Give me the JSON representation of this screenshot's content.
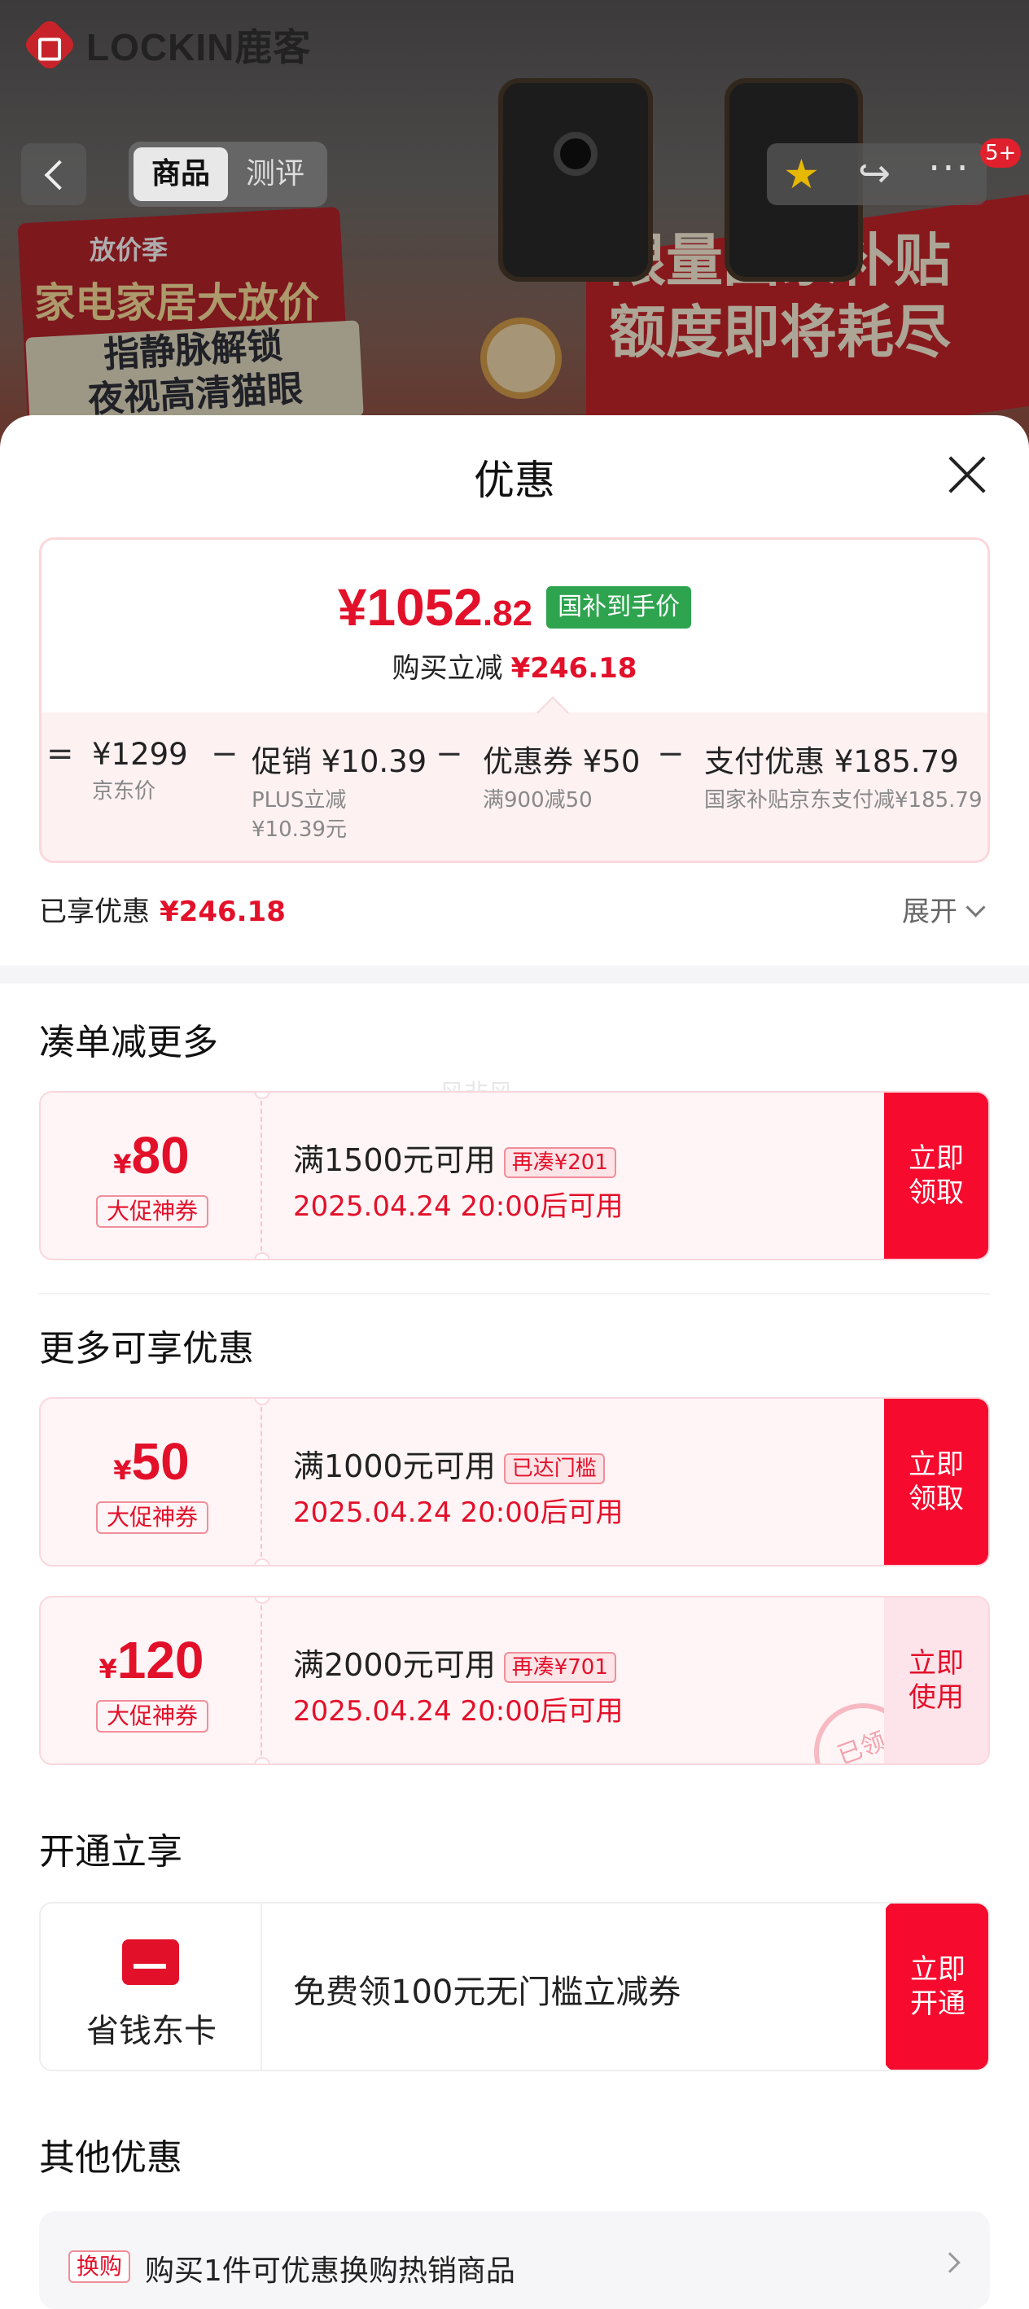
{
  "hero": {
    "brand": "LOCKIN鹿客",
    "tabs": [
      "商品",
      "测评"
    ],
    "badge": "5+",
    "promo": {
      "mini": "放价季",
      "line1": "家电家居大放价",
      "line2a": "指静脉解锁",
      "line2b": "夜视高清猫眼"
    },
    "banner": [
      "限量国家补贴",
      "额度即将耗尽"
    ]
  },
  "sheet": {
    "title": "优惠",
    "final_price_int": "¥1052",
    "final_price_dec": ".82",
    "final_badge": "国补到手价",
    "instant_label": "购买立减",
    "instant_value": "¥246.18",
    "breakdown": {
      "eq": "=",
      "jd_value": "¥1299",
      "jd_note": "京东价",
      "minus": "−",
      "promo_value": "促销 ¥10.39",
      "promo_note1": "PLUS立减",
      "promo_note2": "¥10.39元",
      "coupon_value": "优惠券 ¥50",
      "coupon_note": "满900减50",
      "pay_value": "支付优惠 ¥185.79",
      "pay_note": "国家补贴京东支付减¥185.79"
    },
    "enjoyed_label": "已享优惠",
    "enjoyed_value": "¥246.18",
    "expand": "展开"
  },
  "watermark": "风非风",
  "sections": {
    "more_title": "凑单减更多",
    "enjoy_title": "更多可享优惠",
    "open_title": "开通立享",
    "other_title": "其他优惠"
  },
  "coupons": [
    {
      "currency": "¥",
      "amount": "80",
      "tag": "大促神券",
      "condition": "满1500元可用",
      "chip": "再凑¥201",
      "time": "2025.04.24 20:00后可用",
      "button": "立即领取"
    },
    {
      "currency": "¥",
      "amount": "50",
      "tag": "大促神券",
      "condition": "满1000元可用",
      "chip": "已达门槛",
      "time": "2025.04.24 20:00后可用",
      "button": "立即领取"
    },
    {
      "currency": "¥",
      "amount": "120",
      "tag": "大促神券",
      "condition": "满2000元可用",
      "chip": "再凑¥701",
      "time": "2025.04.24 20:00后可用",
      "button": "立即使用",
      "stamp": "已领"
    }
  ],
  "membership": {
    "name": "省钱东卡",
    "desc": "免费领100元无门槛立减券",
    "button": "立即开通"
  },
  "other": {
    "chip": "换购",
    "text": "购买1件可优惠换购热销商品"
  },
  "colors": {
    "accent": "#e3102a",
    "button": "#f60a2e",
    "green_badge": "#2ea44f"
  }
}
